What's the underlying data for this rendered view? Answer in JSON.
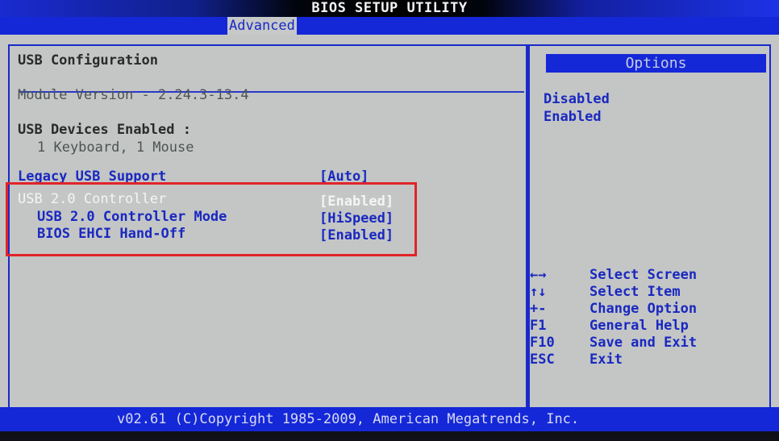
{
  "window": {
    "title": "BIOS SETUP UTILITY"
  },
  "menu": {
    "tabs": [
      {
        "label": "Advanced",
        "active": true
      }
    ]
  },
  "main": {
    "section_title": "USB Configuration",
    "module_version": "Module Version - 2.24.3-13.4",
    "devices_label": "USB Devices Enabled :",
    "devices_value": "1 Keyboard, 1 Mouse",
    "settings": [
      {
        "label": "Legacy USB Support",
        "value": "[Auto]"
      },
      {
        "label": "USB 2.0 Controller",
        "value": "[Enabled]",
        "selected": true
      },
      {
        "label": "USB 2.0 Controller Mode",
        "value": "[HiSpeed]"
      },
      {
        "label": "BIOS EHCI Hand-Off",
        "value": "[Enabled]"
      }
    ]
  },
  "side": {
    "options_title": "Options",
    "options": [
      "Disabled",
      "Enabled"
    ],
    "help": [
      {
        "key": "←→",
        "key_icon": "left-right-arrows-icon",
        "desc": "Select Screen"
      },
      {
        "key": "↑↓",
        "key_icon": "up-down-arrows-icon",
        "desc": "Select Item"
      },
      {
        "key": "+-",
        "key_icon": "plus-minus-icon",
        "desc": "Change Option"
      },
      {
        "key": "F1",
        "desc": "General Help"
      },
      {
        "key": "F10",
        "desc": "Save and Exit"
      },
      {
        "key": "ESC",
        "desc": "Exit"
      }
    ]
  },
  "footer": {
    "text": "v02.61 (C)Copyright 1985-2009, American Megatrends, Inc."
  },
  "colors": {
    "accent_blue": "#1428d8",
    "panel_gray": "#c3c6c5",
    "highlight_red": "#e0242a"
  }
}
